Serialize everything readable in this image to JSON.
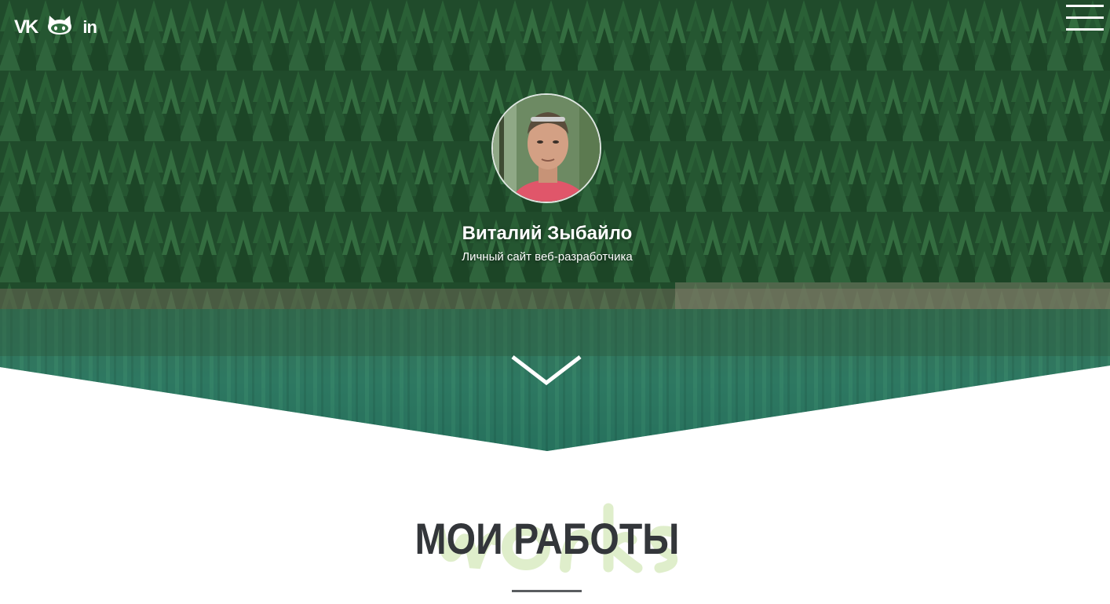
{
  "header": {
    "social": [
      {
        "name": "vk",
        "label": "VK"
      },
      {
        "name": "github",
        "label": ""
      },
      {
        "name": "linkedin",
        "label": "in"
      }
    ],
    "menu_icon": "hamburger-icon"
  },
  "hero": {
    "name": "Виталий Зыбайло",
    "subtitle": "Личный сайт веб-разработчика",
    "scroll_icon": "chevron-down-icon"
  },
  "section": {
    "title": "МОИ РАБОТЫ",
    "background_word": "works"
  },
  "colors": {
    "forest_dark": "#1e4a2e",
    "forest_mid": "#2f6a3f",
    "water": "#2e6f5a",
    "title": "#33363a",
    "accent_script": "#dfeecb"
  }
}
